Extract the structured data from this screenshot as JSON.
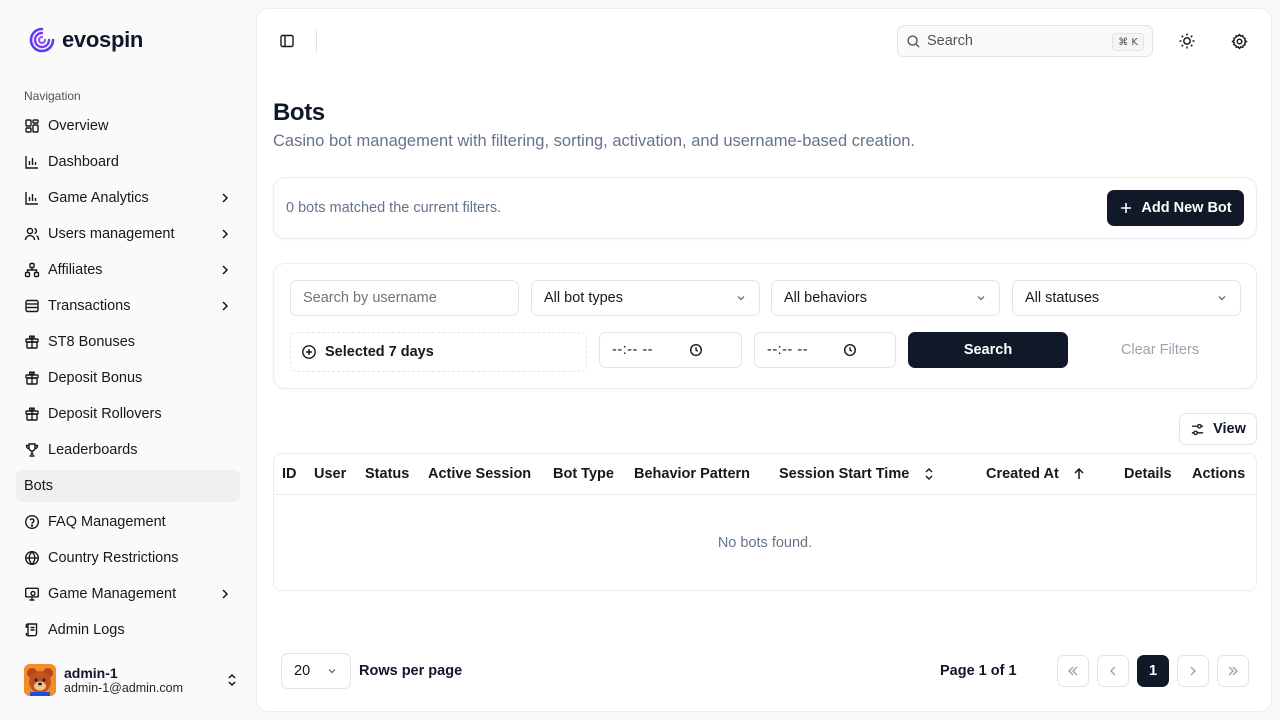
{
  "brand": {
    "name": "evospin"
  },
  "sidebar": {
    "heading": "Navigation",
    "items": [
      {
        "label": "Overview",
        "icon": "layout-grid-icon",
        "chevron": false,
        "active": false
      },
      {
        "label": "Dashboard",
        "icon": "bar-chart-icon",
        "chevron": false,
        "active": false
      },
      {
        "label": "Game Analytics",
        "icon": "bar-chart-icon",
        "chevron": true,
        "active": false
      },
      {
        "label": "Users management",
        "icon": "users-icon",
        "chevron": true,
        "active": false
      },
      {
        "label": "Affiliates",
        "icon": "network-icon",
        "chevron": true,
        "active": false
      },
      {
        "label": "Transactions",
        "icon": "wallet-icon",
        "chevron": true,
        "active": false
      },
      {
        "label": "ST8 Bonuses",
        "icon": "gift-icon",
        "chevron": false,
        "active": false
      },
      {
        "label": "Deposit Bonus",
        "icon": "gift-icon",
        "chevron": false,
        "active": false
      },
      {
        "label": "Deposit Rollovers",
        "icon": "gift-icon",
        "chevron": false,
        "active": false
      },
      {
        "label": "Leaderboards",
        "icon": "trophy-icon",
        "chevron": false,
        "active": false
      },
      {
        "label": "Bots",
        "icon": "",
        "chevron": false,
        "active": true
      },
      {
        "label": "FAQ Management",
        "icon": "help-circle-icon",
        "chevron": false,
        "active": false
      },
      {
        "label": "Country Restrictions",
        "icon": "globe-icon",
        "chevron": false,
        "active": false
      },
      {
        "label": "Game Management",
        "icon": "monitor-icon",
        "chevron": true,
        "active": false
      },
      {
        "label": "Admin Logs",
        "icon": "scroll-icon",
        "chevron": false,
        "active": false
      }
    ],
    "user": {
      "name": "admin-1",
      "email": "admin-1@admin.com"
    }
  },
  "topbar": {
    "search_placeholder": "Search",
    "search_shortcut": "⌘ K"
  },
  "page": {
    "title": "Bots",
    "subtitle": "Casino bot management with filtering, sorting, activation, and username-based creation."
  },
  "summary": {
    "text": "0 bots matched the current filters.",
    "add_button": "Add New Bot"
  },
  "filters": {
    "username_placeholder": "Search by username",
    "bot_type": "All bot types",
    "behavior": "All behaviors",
    "status": "All statuses",
    "date_range": "Selected 7 days",
    "time_from": "--:-- --",
    "time_to": "--:-- --",
    "search_button": "Search",
    "clear_button": "Clear Filters"
  },
  "table": {
    "view_button": "View",
    "columns": [
      "ID",
      "User",
      "Status",
      "Active Session",
      "Bot Type",
      "Behavior Pattern",
      "Session Start Time",
      "Created At",
      "Details",
      "Actions"
    ],
    "empty_text": "No bots found."
  },
  "pagination": {
    "rows_per_page_value": "20",
    "rows_per_page_label": "Rows per page",
    "page_info": "Page 1 of 1",
    "current_page": "1"
  },
  "colors": {
    "primary": "#111827",
    "active_nav_bg": "#f0f0f2",
    "muted_text": "#64748b",
    "brand_purple": "#6d3cf6"
  }
}
